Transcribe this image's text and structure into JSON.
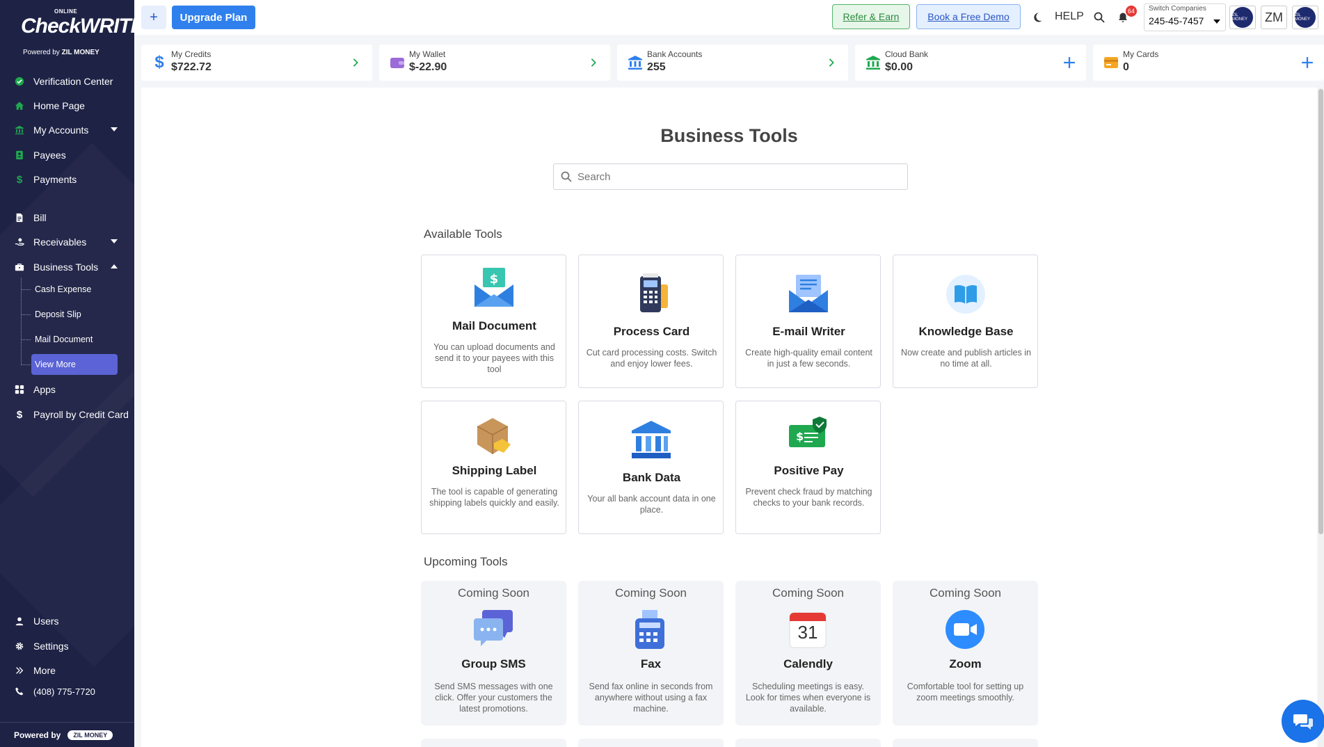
{
  "sidebar": {
    "logo": {
      "online": "ONLINE",
      "brand": "CheckWRITER",
      "powered_by": "Powered by",
      "company": "ZIL MONEY"
    },
    "items": [
      {
        "label": "Verification Center"
      },
      {
        "label": "Home Page"
      },
      {
        "label": "My Accounts"
      },
      {
        "label": "Payees"
      },
      {
        "label": "Payments"
      },
      {
        "label": "Bill"
      },
      {
        "label": "Receivables"
      },
      {
        "label": "Business Tools"
      },
      {
        "label": "Apps"
      },
      {
        "label": "Payroll by Credit Card"
      },
      {
        "label": "Users"
      },
      {
        "label": "Settings"
      },
      {
        "label": "More"
      },
      {
        "label": "(408) 775-7720"
      }
    ],
    "subitems": [
      {
        "label": "Cash Expense"
      },
      {
        "label": "Deposit Slip"
      },
      {
        "label": "Mail Document"
      },
      {
        "label": "View More"
      }
    ],
    "footer": {
      "powered_by": "Powered by",
      "company": "ZIL MONEY"
    }
  },
  "topbar": {
    "plus": "+",
    "upgrade": "Upgrade Plan",
    "refer": "Refer & Earn",
    "demo": "Book a Free Demo",
    "help": "HELP",
    "notifications": "64",
    "company_label": "Switch Companies",
    "company_value": "245-45-7457",
    "avatar_text": "ZIL MONEY",
    "initials": "ZM"
  },
  "summary": [
    {
      "label": "My Credits",
      "value": "$722.72"
    },
    {
      "label": "My Wallet",
      "value": "$-22.90"
    },
    {
      "label": "Bank Accounts",
      "value": "255"
    },
    {
      "label": "Cloud Bank",
      "value": "$0.00"
    },
    {
      "label": "My Cards",
      "value": "0"
    }
  ],
  "main": {
    "title": "Business Tools",
    "search_placeholder": "Search",
    "available_title": "Available Tools",
    "upcoming_title": "Upcoming Tools",
    "available": [
      {
        "name": "Mail Document",
        "desc": "You can upload documents and send it to your payees with this tool"
      },
      {
        "name": "Process Card",
        "desc": "Cut card processing costs. Switch and enjoy lower fees."
      },
      {
        "name": "E-mail Writer",
        "desc": "Create high-quality email content in just a few seconds."
      },
      {
        "name": "Knowledge Base",
        "desc": "Now create and publish articles in no time at all."
      },
      {
        "name": "Shipping Label",
        "desc": "The tool is capable of generating shipping labels quickly and easily."
      },
      {
        "name": "Bank Data",
        "desc": "Your all bank account data in one place."
      },
      {
        "name": "Positive Pay",
        "desc": "Prevent check fraud by matching checks to your bank records."
      }
    ],
    "upcoming": [
      {
        "badge": "Coming Soon",
        "name": "Group SMS",
        "desc": "Send SMS messages with one click. Offer your customers the latest promotions."
      },
      {
        "badge": "Coming Soon",
        "name": "Fax",
        "desc": "Send fax online in seconds from anywhere without using a fax machine."
      },
      {
        "badge": "Coming Soon",
        "name": "Calendly",
        "desc": "Scheduling meetings is easy. Look for times when everyone is available.",
        "icon_text": "31"
      },
      {
        "badge": "Coming Soon",
        "name": "Zoom",
        "desc": "Comfortable tool for setting up zoom meetings smoothly."
      }
    ]
  },
  "colors": {
    "sidebar": "#1e2245",
    "accent": "#2f80ed",
    "active": "#5b63d6",
    "green": "#1fa84f"
  }
}
